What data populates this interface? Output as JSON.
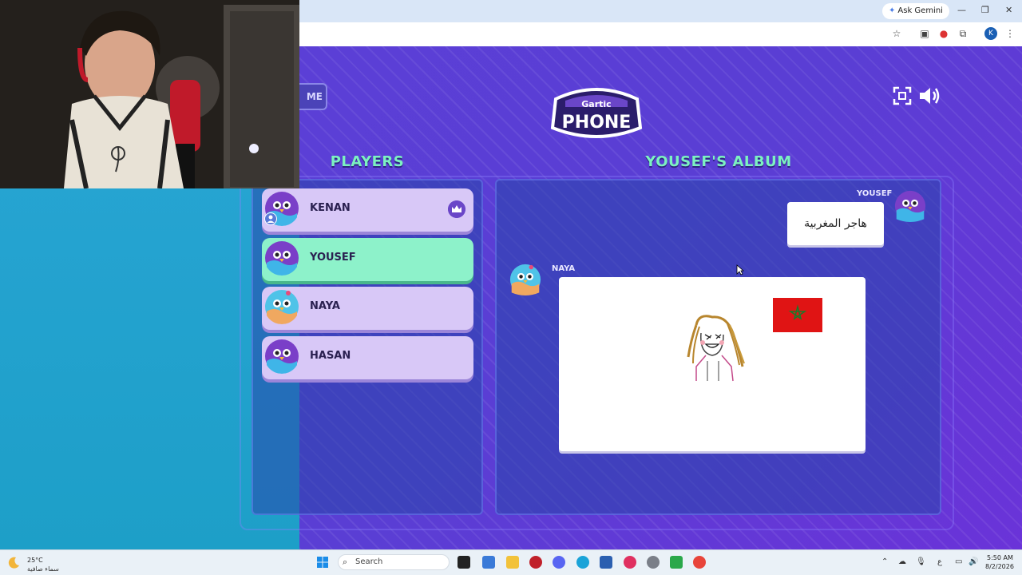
{
  "browser": {
    "ask_gemini": "Ask Gemini",
    "win_minimize": "—",
    "win_restore": "❐",
    "win_close": "✕",
    "profile_initial": "K"
  },
  "game": {
    "home_label": "ME",
    "logo_line1": "Gartic",
    "logo_line2": "PHONE",
    "players_heading": "PLAYERS",
    "album_heading": "YOUSEF'S ALBUM",
    "players": [
      {
        "name": "KENAN",
        "host": true,
        "active": false
      },
      {
        "name": "YOUSEF",
        "host": false,
        "active": true
      },
      {
        "name": "NAYA",
        "host": false,
        "active": false
      },
      {
        "name": "HASAN",
        "host": false,
        "active": false
      }
    ],
    "album": {
      "first_author": "YOUSEF",
      "first_text": "هاجر المغربية",
      "second_author": "NAYA"
    }
  },
  "taskbar": {
    "weather_temp": "25°C",
    "weather_desc": "سماء صافية",
    "search_label": "Search",
    "lang": "ع",
    "time": "5:50 AM",
    "date": "8/2/2026"
  },
  "colors": {
    "heading_green": "#7cf2c0",
    "row_purple": "#d8c8f7",
    "row_active": "#8df2ca",
    "game_bg": "#5b3fd6"
  }
}
